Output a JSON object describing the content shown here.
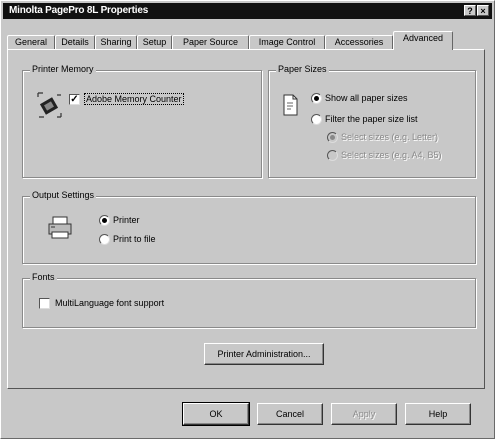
{
  "window": {
    "title": "Minolta PagePro 8L Properties"
  },
  "titlebar_buttons": {
    "help": "?",
    "close": "×"
  },
  "tabs": [
    {
      "label": "General"
    },
    {
      "label": "Details"
    },
    {
      "label": "Sharing"
    },
    {
      "label": "Setup"
    },
    {
      "label": "Paper Source"
    },
    {
      "label": "Image Control"
    },
    {
      "label": "Accessories"
    },
    {
      "label": "Advanced"
    }
  ],
  "printer_memory": {
    "title": "Printer Memory",
    "adobe_counter": {
      "label": "Adobe Memory Counter",
      "checked": true
    }
  },
  "paper_sizes": {
    "title": "Paper Sizes",
    "show_all": {
      "label": "Show all paper sizes",
      "selected": true
    },
    "filter": {
      "label": "Filter the paper size list",
      "selected": false
    },
    "option_a": {
      "label": "Select sizes (e.g. Letter)"
    },
    "option_b": {
      "label": "Select sizes (e.g. A4, B5)"
    }
  },
  "output_settings": {
    "title": "Output Settings",
    "printer": {
      "label": "Printer",
      "selected": true
    },
    "print_to_file": {
      "label": "Print to file",
      "selected": false
    }
  },
  "fonts": {
    "title": "Fonts",
    "multilanguage": {
      "label": "MultiLanguage font support",
      "checked": false
    }
  },
  "buttons": {
    "printer_admin": "Printer Administration...",
    "ok": "OK",
    "cancel": "Cancel",
    "apply": "Apply",
    "help": "Help"
  }
}
